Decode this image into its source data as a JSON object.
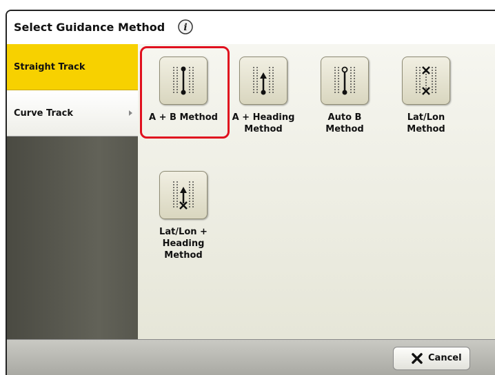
{
  "header": {
    "title": "Select Guidance Method",
    "info_icon": "info-icon"
  },
  "sidebar": {
    "tabs": [
      {
        "label": "Straight Track",
        "active": true
      },
      {
        "label": "Curve Track",
        "active": false
      }
    ]
  },
  "methods": [
    {
      "label_line1": "A + B Method",
      "label_line2": "",
      "label_line3": "",
      "icon": "a-b-method-icon",
      "selected": true
    },
    {
      "label_line1": "A + Heading",
      "label_line2": "Method",
      "label_line3": "",
      "icon": "a-heading-method-icon",
      "selected": false
    },
    {
      "label_line1": "Auto B",
      "label_line2": "Method",
      "label_line3": "",
      "icon": "auto-b-method-icon",
      "selected": false
    },
    {
      "label_line1": "Lat/Lon",
      "label_line2": "Method",
      "label_line3": "",
      "icon": "lat-lon-method-icon",
      "selected": false
    },
    {
      "label_line1": "Lat/Lon +",
      "label_line2": "Heading",
      "label_line3": "Method",
      "icon": "lat-lon-heading-method-icon",
      "selected": false
    }
  ],
  "footer": {
    "cancel_label": "Cancel",
    "cancel_icon": "x-icon"
  },
  "colors": {
    "active_tab": "#f7d100",
    "selection_highlight": "#e0101e",
    "sidebar": "#57574e"
  }
}
